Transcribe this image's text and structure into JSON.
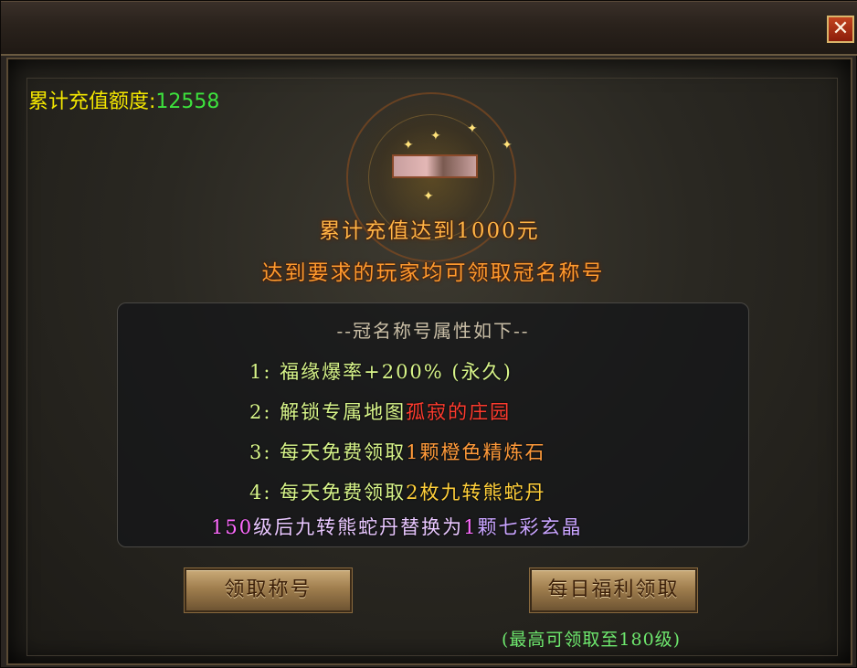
{
  "window": {
    "close_label": "✕"
  },
  "recharge": {
    "label": "累计充值额度:",
    "value": "12558"
  },
  "headlines": {
    "line1": "累计充值达到1000元",
    "line2": "达到要求的玩家均可领取冠名称号"
  },
  "attributes": {
    "header": "--冠名称号属性如下--",
    "item1": "1: 福缘爆率+200% (永久)",
    "item2_prefix": "2: 解锁专属地图",
    "item2_highlight": "孤寂的庄园",
    "item3_prefix": "3: 每天免费领取",
    "item3_highlight": "1颗橙色精炼石",
    "item4_prefix": "4: 每天免费领取",
    "item4_highlight": "2枚九转熊蛇丹",
    "item5_a": "150",
    "item5_b": "级后九转熊蛇丹替换为",
    "item5_c": "1",
    "item5_d": "颗七彩玄晶"
  },
  "buttons": {
    "claim_title": "领取称号",
    "daily_welfare": "每日福利领取"
  },
  "note": {
    "max_level": "(最高可领取至180级)"
  },
  "colors": {
    "recharge_label": "#f3e600",
    "recharge_value": "#3de23d",
    "headline": "#ffb446",
    "attr_text": "#d8f58a",
    "map_highlight": "#ff3b2e",
    "note": "#6ee86e"
  }
}
